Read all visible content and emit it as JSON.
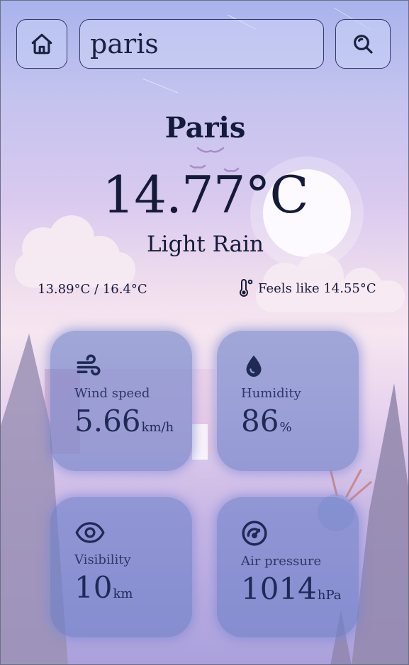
{
  "search": {
    "value": "paris"
  },
  "weather": {
    "city": "Paris",
    "temperature": "14.77°C",
    "condition": "Light Rain",
    "min_max": "13.89°C / 16.4°C",
    "feels_like": "Feels like 14.55°C"
  },
  "cards": {
    "wind": {
      "label": "Wind speed",
      "value": "5.66",
      "unit": "km/h"
    },
    "humidity": {
      "label": "Humidity",
      "value": "86",
      "unit": "%"
    },
    "visibility": {
      "label": "Visibility",
      "value": "10",
      "unit": "km"
    },
    "pressure": {
      "label": "Air pressure",
      "value": "1014",
      "unit": "hPa"
    }
  },
  "colors": {
    "text": "#141b3a",
    "card": "#6c80c8",
    "border": "#2d3a66"
  },
  "icons": [
    "home-icon",
    "search-icon",
    "thermometer-icon",
    "wind-icon",
    "droplet-icon",
    "eye-icon",
    "gauge-icon"
  ]
}
